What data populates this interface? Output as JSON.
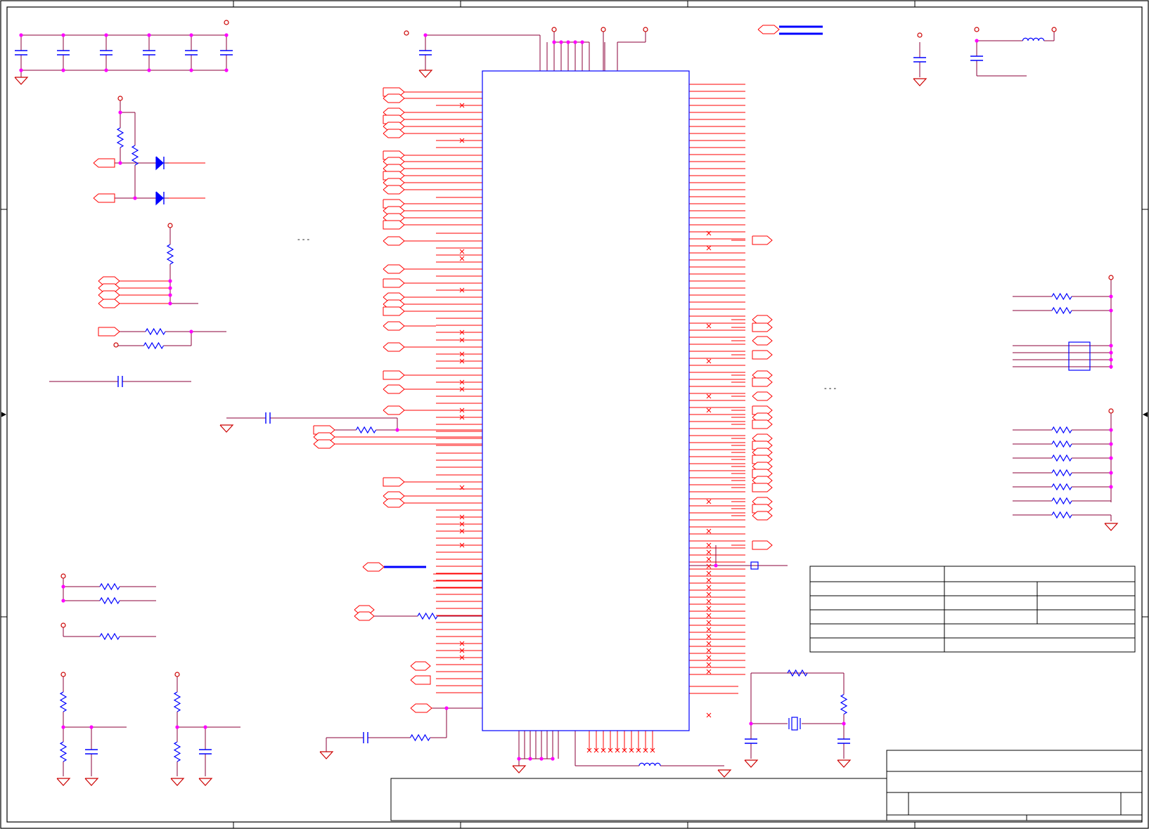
{
  "sheet": {
    "zone_separators": "- - -",
    "title_block": {
      "rows": [
        {
          "label": "",
          "value": "",
          "extra": ""
        },
        {
          "label": "",
          "value": "",
          "extra": ""
        },
        {
          "label": "",
          "value": "",
          "extra": ""
        },
        {
          "label": "",
          "value": "",
          "extra": ""
        },
        {
          "label": "",
          "value": "",
          "extra": ""
        }
      ],
      "title": "",
      "subtitle": "",
      "doc_number": "",
      "revision": "",
      "sheet_of": ""
    }
  },
  "colors": {
    "border": "#000000",
    "wire": "#8b0038",
    "net_label": "#ff0000",
    "component": "#0000ff",
    "junction": "#ff00ff",
    "power": "#cc0000"
  },
  "icons": {
    "ground": "ground-icon",
    "power_rail": "power-rail-icon",
    "capacitor": "capacitor-icon",
    "resistor": "resistor-icon",
    "inductor": "inductor-icon",
    "diode": "diode-icon",
    "crystal": "crystal-icon",
    "net_flag": "net-flag-icon",
    "no_connect": "no-connect-icon"
  }
}
